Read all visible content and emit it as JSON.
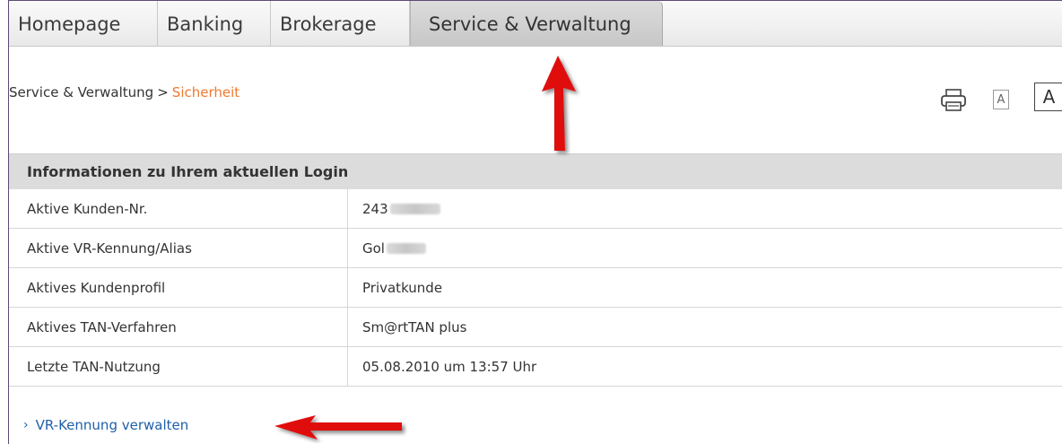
{
  "tabs": [
    {
      "label": "Homepage"
    },
    {
      "label": "Banking"
    },
    {
      "label": "Brokerage"
    },
    {
      "label": "Service & Verwaltung",
      "active": true
    }
  ],
  "breadcrumb": {
    "parent": "Service & Verwaltung",
    "separator": ">",
    "current": "Sicherheit"
  },
  "tools": {
    "print_icon": "printer-icon",
    "font_small_label": "A",
    "font_large_label": "A"
  },
  "section": {
    "title": "Informationen zu Ihrem aktuellen Login"
  },
  "login_info": [
    {
      "label": "Aktive Kunden-Nr.",
      "value": "243",
      "redacted": true
    },
    {
      "label": "Aktive VR-Kennung/Alias",
      "value": "Gol",
      "redacted": true
    },
    {
      "label": "Aktives Kundenprofil",
      "value": "Privatkunde"
    },
    {
      "label": "Aktives TAN-Verfahren",
      "value": "Sm@rtTAN plus"
    },
    {
      "label": "Letzte TAN-Nutzung",
      "value": "05.08.2010 um 13:57 Uhr"
    }
  ],
  "links": {
    "manage_label": "VR-Kennung verwalten",
    "chevron_icon": "chevron-right-icon"
  },
  "colors": {
    "breadcrumb_current": "#ee7a2f",
    "link": "#1f5fa8",
    "arrow": "#e01010",
    "section_bg": "#dcdcdc"
  }
}
